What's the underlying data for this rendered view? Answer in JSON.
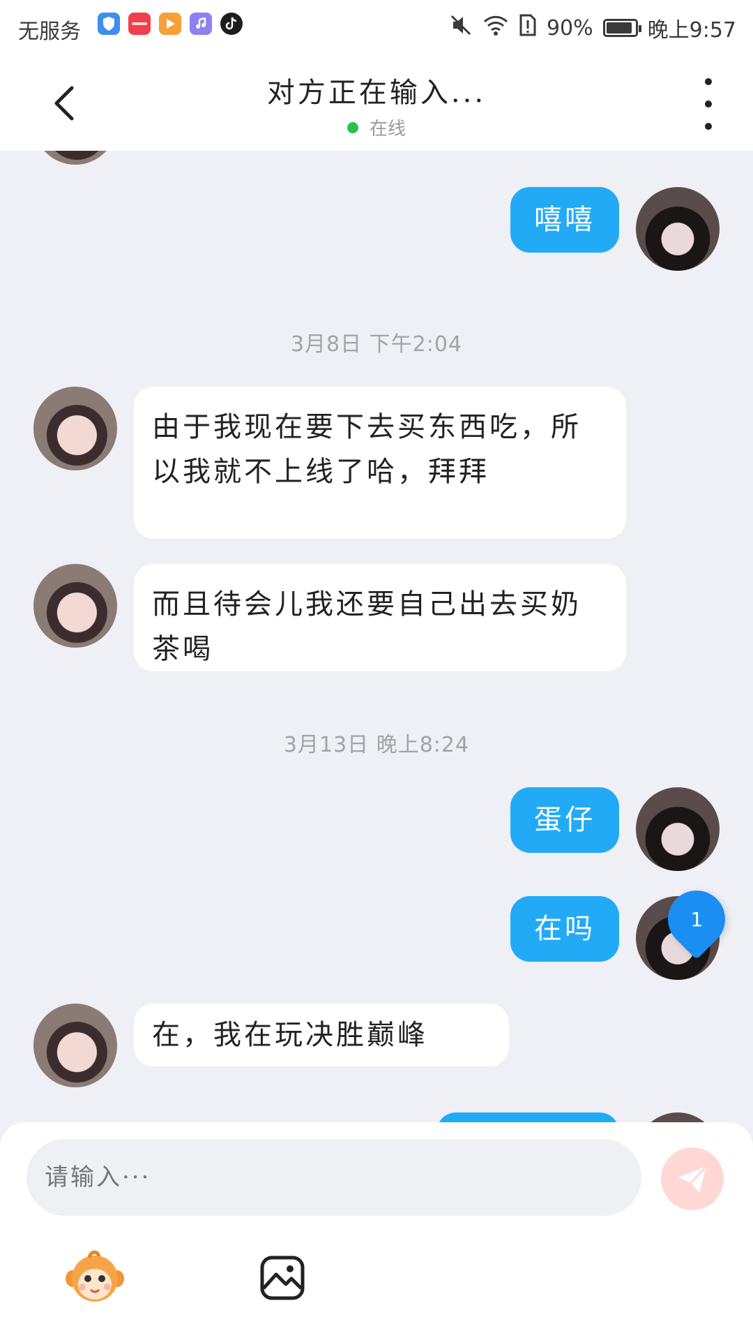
{
  "status_bar": {
    "carrier": "无服务",
    "battery_level": 0.9,
    "battery_text": "90%",
    "time": "晚上9:57",
    "app_icons": [
      "shield-app-icon",
      "huawei-mall-app-icon",
      "video-player-app-icon",
      "music-app-icon",
      "tiktok-app-icon"
    ]
  },
  "header": {
    "title": "对方正在输入...",
    "status": "在线",
    "online_color": "#27c44b"
  },
  "messages": [
    {
      "from": "me",
      "text": "嘻嘻"
    },
    {
      "timestamp": "3月8日  下午2:04"
    },
    {
      "from": "them",
      "text": "由于我现在要下去买东西吃，所以我就不上线了哈，拜拜"
    },
    {
      "from": "them",
      "text": "而且待会儿我还要自己出去买奶茶喝"
    },
    {
      "timestamp": "3月13日  晚上8:24"
    },
    {
      "from": "me",
      "text": "蛋仔"
    },
    {
      "from": "me",
      "text": "在吗"
    },
    {
      "from": "them",
      "text": "在，我在玩决胜巅峰"
    }
  ],
  "unread_badge": "1",
  "input": {
    "placeholder": "请输入···"
  },
  "colors": {
    "accent": "#22aaf7",
    "badge": "#1a8ef2",
    "send_disabled": "#ffd8d6"
  }
}
